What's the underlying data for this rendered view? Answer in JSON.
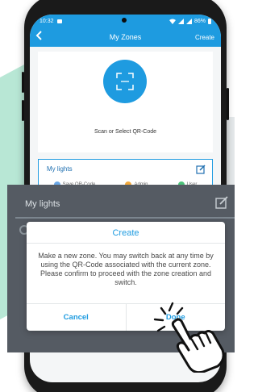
{
  "status_bar": {
    "time": "10:32",
    "battery": "86%"
  },
  "app_bar": {
    "title": "My Zones",
    "back_icon": "chevron-left-icon",
    "action_label": "Create"
  },
  "scan": {
    "icon": "qr-scan-icon",
    "label": "Scan or Select QR-Code"
  },
  "zone_card": {
    "title": "My lights",
    "edit_icon": "edit-icon",
    "tabs": [
      {
        "label": "Save QR-Code",
        "color": "#6aa7e6"
      },
      {
        "label": "Admin",
        "color": "#f2a93b"
      },
      {
        "label": "User",
        "color": "#4cc27a"
      }
    ]
  },
  "overlay_card": {
    "title": "My lights"
  },
  "dialog": {
    "title": "Create",
    "message": "Make a new zone. You may switch back at any time by using the QR-Code associated with the current zone. Please confirm to proceed with the zone creation and switch.",
    "cancel_label": "Cancel",
    "done_label": "Done"
  },
  "colors": {
    "brand": "#1e9be0",
    "overlay": "#555b63",
    "accent_green": "#7ed3b2"
  }
}
